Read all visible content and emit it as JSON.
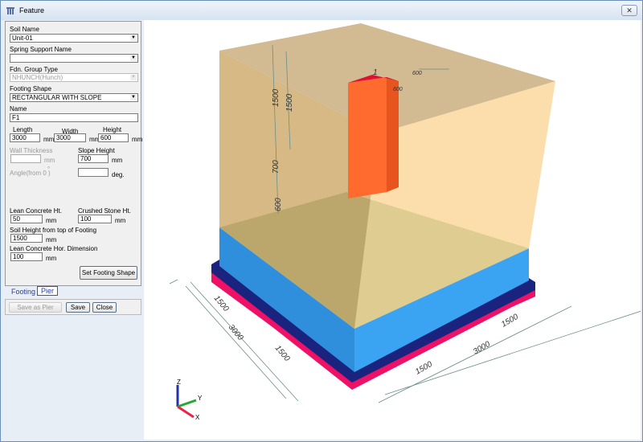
{
  "window": {
    "title": "Feature",
    "close": "✕"
  },
  "form": {
    "soil_name_label": "Soil Name",
    "soil_name": "Unit-01",
    "spring_label": "Spring Support Name",
    "spring": "",
    "fdn_label": "Fdn. Group Type",
    "fdn": "NHUNCH(Hunch)",
    "shape_label": "Footing Shape",
    "shape": "RECTANGULAR WITH SLOPE",
    "name_label": "Name",
    "name": "F1",
    "length_label": "Length",
    "length": "3000",
    "width_label": "Width",
    "width": "3000",
    "height_label": "Height",
    "height": "600",
    "unit_mm": "mm",
    "unit_deg": "deg.",
    "wall_label": "Wall Thickness",
    "wall": "",
    "slope_label": "Slope Height",
    "slope": "700",
    "angle_label": "Angle(from 0  )",
    "angle_mark": "°",
    "angle": "",
    "lean_label": "Lean Concrete Ht.",
    "lean": "50",
    "crushed_label": "Crushed Stone Ht.",
    "crushed": "100",
    "soilh_label": "Soil Height from top of Footing",
    "soilh": "1500",
    "leanhor_label": "Lean Concrete Hor. Dimension",
    "leanhor": "100",
    "set_shape": "Set Footing Shape"
  },
  "tabs": [
    {
      "label": "Footing",
      "active": true
    },
    {
      "label": "Pier",
      "active": false
    }
  ],
  "buttons": {
    "save_as_pier": "Save as Pier",
    "save": "Save",
    "close": "Close"
  },
  "view3d": {
    "colors": {
      "soil": "#c9a15e",
      "pier": "#ff5522",
      "footing": "#3aa0ee",
      "lean": "#1a237e",
      "crushed": "#ee1166"
    },
    "dims": {
      "pier_label": "1",
      "pier_w": "600",
      "pier_d": "600",
      "soil_1": "1500",
      "soil_2": "1500",
      "slope": "700",
      "height": "600",
      "left_half_1": "1500",
      "left_total": "3000",
      "left_half_2": "1500",
      "right_half_1": "1500",
      "right_total": "3000",
      "right_half_2": "1500"
    },
    "axes": {
      "x": "X",
      "y": "Y",
      "z": "Z"
    }
  }
}
